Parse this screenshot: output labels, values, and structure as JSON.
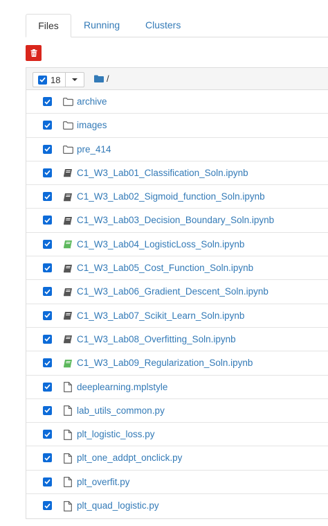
{
  "tabs": [
    {
      "label": "Files"
    },
    {
      "label": "Running"
    },
    {
      "label": "Clusters"
    }
  ],
  "toolbar": {
    "selected_count": "18",
    "breadcrumb": "/"
  },
  "colors": {
    "link": "#337ab7",
    "checkbox": "#0d6bd8",
    "delete": "#d9261c",
    "notebook_idle": "#555555",
    "notebook_running": "#5cb85c"
  },
  "files": [
    {
      "name": "archive",
      "type": "folder"
    },
    {
      "name": "images",
      "type": "folder"
    },
    {
      "name": "pre_414",
      "type": "folder"
    },
    {
      "name": "C1_W3_Lab01_Classification_Soln.ipynb",
      "type": "notebook"
    },
    {
      "name": "C1_W3_Lab02_Sigmoid_function_Soln.ipynb",
      "type": "notebook"
    },
    {
      "name": "C1_W3_Lab03_Decision_Boundary_Soln.ipynb",
      "type": "notebook"
    },
    {
      "name": "C1_W3_Lab04_LogisticLoss_Soln.ipynb",
      "type": "notebook-running"
    },
    {
      "name": "C1_W3_Lab05_Cost_Function_Soln.ipynb",
      "type": "notebook"
    },
    {
      "name": "C1_W3_Lab06_Gradient_Descent_Soln.ipynb",
      "type": "notebook"
    },
    {
      "name": "C1_W3_Lab07_Scikit_Learn_Soln.ipynb",
      "type": "notebook"
    },
    {
      "name": "C1_W3_Lab08_Overfitting_Soln.ipynb",
      "type": "notebook"
    },
    {
      "name": "C1_W3_Lab09_Regularization_Soln.ipynb",
      "type": "notebook-running"
    },
    {
      "name": "deeplearning.mplstyle",
      "type": "file"
    },
    {
      "name": "lab_utils_common.py",
      "type": "file"
    },
    {
      "name": "plt_logistic_loss.py",
      "type": "file"
    },
    {
      "name": "plt_one_addpt_onclick.py",
      "type": "file"
    },
    {
      "name": "plt_overfit.py",
      "type": "file"
    },
    {
      "name": "plt_quad_logistic.py",
      "type": "file"
    }
  ]
}
